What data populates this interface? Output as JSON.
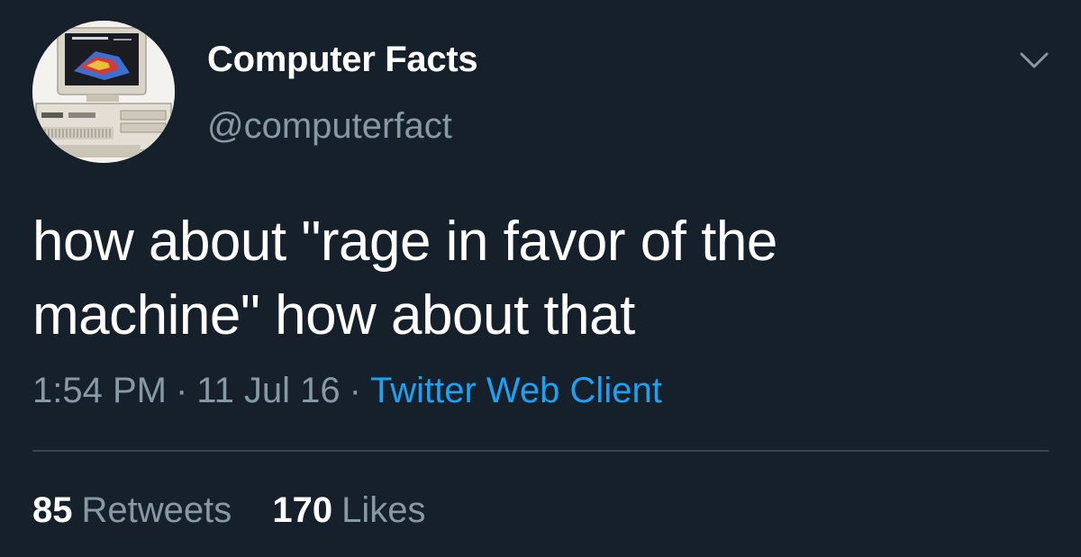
{
  "tweet": {
    "display_name": "Computer Facts",
    "handle": "@computerfact",
    "text_lines": [
      "how about \"rage in favor of the",
      "machine\" how about that"
    ],
    "time": "1:54 PM",
    "date": "11 Jul 16",
    "separator": "·",
    "source": "Twitter Web Client",
    "stats": {
      "retweets_count": "85",
      "retweets_label": "Retweets",
      "likes_count": "170",
      "likes_label": "Likes"
    },
    "menu_icon": "chevron-down-icon",
    "avatar_icon": "vintage-computer-avatar"
  },
  "colors": {
    "background": "#15202b",
    "primary_text": "#ffffff",
    "secondary_text": "#8899a6",
    "link": "#1da1f2",
    "divider": "#38444d"
  }
}
